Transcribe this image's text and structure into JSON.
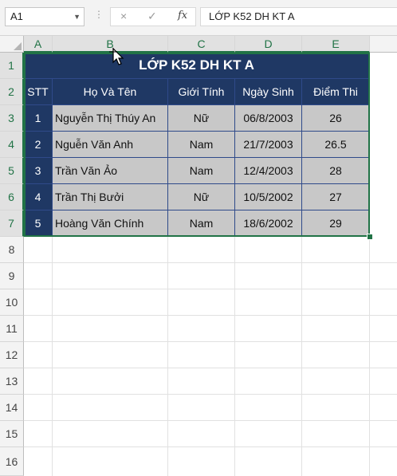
{
  "formula_bar": {
    "name_box": "A1",
    "dots": "⋮",
    "cancel_icon": "×",
    "enter_icon": "✓",
    "fx_label": "fx",
    "content": "LỚP K52 DH KT A"
  },
  "columns": [
    "A",
    "B",
    "C",
    "D",
    "E"
  ],
  "rows": [
    "1",
    "2",
    "3",
    "4",
    "5",
    "6",
    "7",
    "8",
    "9",
    "10",
    "11",
    "12",
    "13",
    "14",
    "15",
    "16"
  ],
  "table": {
    "title": "LỚP K52 DH KT A",
    "headers": [
      "STT",
      "Họ Và Tên",
      "Giới Tính",
      "Ngày Sinh",
      "Điểm Thi"
    ],
    "records": [
      [
        "1",
        "Nguyễn Thị Thúy An",
        "Nữ",
        "06/8/2003",
        "26"
      ],
      [
        "2",
        "Nguễn Văn Anh",
        "Nam",
        "21/7/2003",
        "26.5"
      ],
      [
        "3",
        "Trần Văn Ảo",
        "Nam",
        "12/4/2003",
        "28"
      ],
      [
        "4",
        "Trần Thị Bưởi",
        "Nữ",
        "10/5/2002",
        "27"
      ],
      [
        "5",
        "Hoàng Văn Chính",
        "Nam",
        "18/6/2002",
        "29"
      ]
    ]
  },
  "colors": {
    "header_fill": "#1f3864",
    "data_fill": "#c8c8c8",
    "selection": "#217346"
  }
}
